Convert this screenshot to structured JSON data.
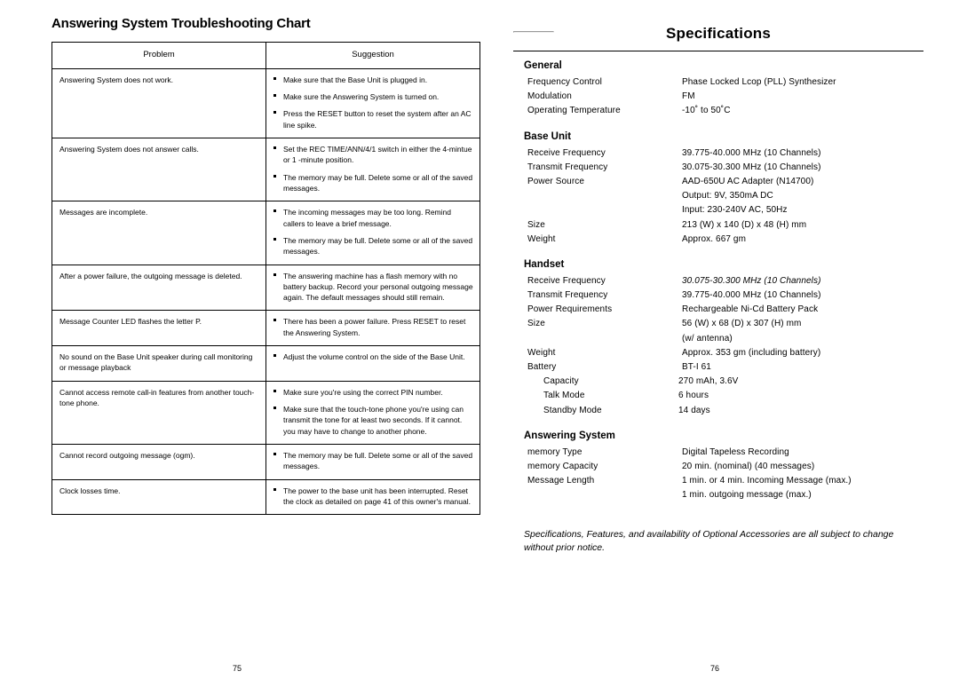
{
  "left_page": {
    "title": "Answering System Troubleshooting Chart",
    "page_number": "75",
    "table": {
      "headers": [
        "Problem",
        "Suggestion"
      ],
      "rows": [
        {
          "problem": "Answering System does not work.",
          "suggestions": [
            "Make sure that the Base Unit is plugged in.",
            "Make sure the Answering System is turned on.",
            "Press the RESET button to reset the system after an AC line spike."
          ]
        },
        {
          "problem": "Answering System does not answer calls.",
          "suggestions": [
            "Set the REC TIME/ANN/4/1 switch in either the 4-mintue or 1 -minute position.",
            "The memory may be full. Delete some or all of the saved messages."
          ]
        },
        {
          "problem": "Messages are incomplete.",
          "suggestions": [
            "The incoming messages may be too long. Remind callers to leave a brief message.",
            "The memory may be full. Delete some or all of the saved messages."
          ]
        },
        {
          "problem": "After a power failure, the outgoing message is deleted.",
          "suggestions": [
            "The answering machine has a flash memory with no battery backup. Record your personal outgoing message again. The default messages should still remain."
          ]
        },
        {
          "problem": "Message Counter LED flashes the letter P.",
          "suggestions": [
            "There has been a power failure. Press RESET to reset the Answering System."
          ]
        },
        {
          "problem": "No sound on the Base Unit speaker during call monitoring or message playback",
          "suggestions": [
            "Adjust the volume control on the side of the Base Unit."
          ]
        },
        {
          "problem": "Cannot access remote call-in features from another touch-tone phone.",
          "suggestions": [
            "Make sure you're using the correct PIN number.",
            "Make sure that the touch-tone phone you're using can transmit the tone for at least two seconds. If it cannot. you may have to change to another phone."
          ]
        },
        {
          "problem": "Cannot record outgoing message (ogm).",
          "suggestions": [
            "The memory may be full. Delete some or all of the saved messages."
          ]
        },
        {
          "problem": "Clock losses time.",
          "suggestions": [
            "The power to the base unit has been interrupted. Reset the clock as detailed on page 41 of this owner's manual."
          ]
        }
      ]
    }
  },
  "right_page": {
    "title": "Specifications",
    "page_number": "76",
    "sections": [
      {
        "heading": "General",
        "rows": [
          {
            "label": "Frequency Control",
            "value": "Phase Locked Lcop (PLL) Synthesizer"
          },
          {
            "label": "Modulation",
            "value": "FM"
          },
          {
            "label": "Operating Temperature",
            "value": "-10˚ to 50˚C"
          }
        ]
      },
      {
        "heading": "Base Unit",
        "rows": [
          {
            "label": "Receive Frequency",
            "value": "39.775-40.000 MHz (10 Channels)"
          },
          {
            "label": "Transmit Frequency",
            "value": "30.075-30.300 MHz (10 Channels)"
          },
          {
            "label": "Power Source",
            "value": "AAD-650U AC Adapter (N14700)",
            "extra": [
              "Output: 9V, 350mA DC",
              "Input: 230-240V AC, 50Hz"
            ]
          },
          {
            "label": "Size",
            "value": "213 (W) x 140 (D) x 48 (H) mm"
          },
          {
            "label": "Weight",
            "value": "Approx. 667 gm"
          }
        ]
      },
      {
        "heading": "Handset",
        "rows": [
          {
            "label": "Receive Frequency",
            "value": "30.075-30.300 MHz (10 Channels)",
            "italic_value": true
          },
          {
            "label": "Transmit Frequency",
            "value": "39.775-40.000 MHz (10 Channels)"
          },
          {
            "label": "Power Requirements",
            "value": "Rechargeable Ni-Cd Battery Pack"
          },
          {
            "label": "Size",
            "value": "56 (W) x 68 (D) x 307 (H) mm",
            "extra": [
              "(w/ antenna)"
            ]
          },
          {
            "label": "Weight",
            "value": "Approx. 353 gm (including battery)"
          },
          {
            "label": "Battery",
            "value": "BT-I 61"
          },
          {
            "label": "Capacity",
            "value": "270 mAh, 3.6V",
            "indent": true
          },
          {
            "label": "Talk Mode",
            "value": "6 hours",
            "indent": true
          },
          {
            "label": "Standby Mode",
            "value": "14 days",
            "indent": true
          }
        ]
      },
      {
        "heading": "Answering System",
        "rows": [
          {
            "label": "memory Type",
            "value": "Digital Tapeless Recording"
          },
          {
            "label": "memory Capacity",
            "value": "20 min. (nominal) (40 messages)"
          },
          {
            "label": "Message Length",
            "value": "1 min. or 4 min. Incoming Message (max.)",
            "extra": [
              "1 min. outgoing message (max.)"
            ]
          }
        ]
      }
    ],
    "footnote": "Specifications, Features, and availability of Optional Accessories are all subject to change without prior notice."
  }
}
